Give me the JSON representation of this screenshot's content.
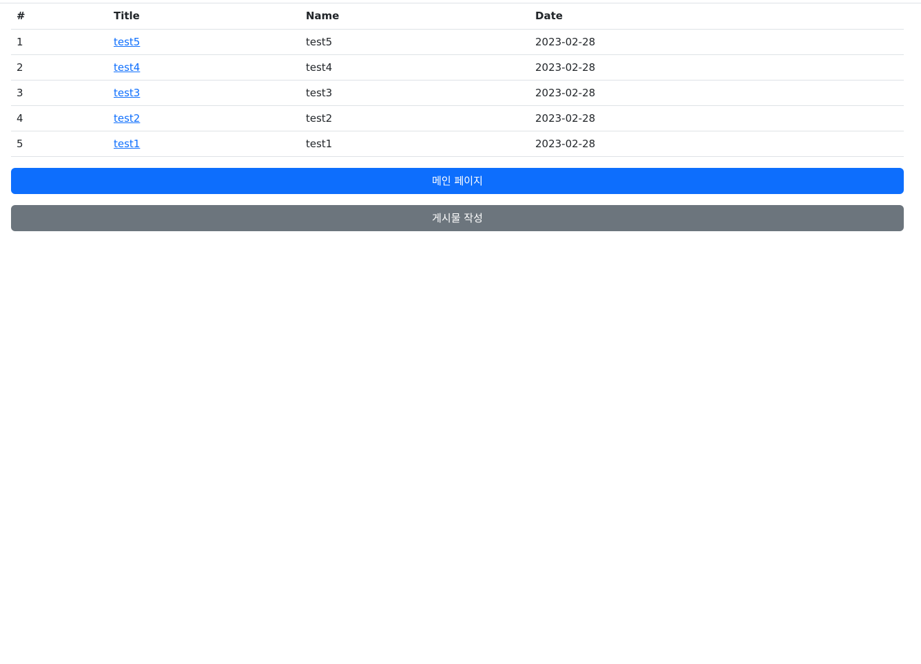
{
  "table": {
    "headers": [
      "#",
      "Title",
      "Name",
      "Date"
    ],
    "rows": [
      {
        "num": "1",
        "title": "test5",
        "name": "test5",
        "date": "2023-02-28"
      },
      {
        "num": "2",
        "title": "test4",
        "name": "test4",
        "date": "2023-02-28"
      },
      {
        "num": "3",
        "title": "test3",
        "name": "test3",
        "date": "2023-02-28"
      },
      {
        "num": "4",
        "title": "test2",
        "name": "test2",
        "date": "2023-02-28"
      },
      {
        "num": "5",
        "title": "test1",
        "name": "test1",
        "date": "2023-02-28"
      }
    ]
  },
  "buttons": {
    "main_page": "메인 페이지",
    "write_post": "게시물 작성"
  },
  "colors": {
    "primary": "#0d6efd",
    "secondary": "#6c757d",
    "link": "#0d6efd",
    "border": "#dee2e6"
  }
}
